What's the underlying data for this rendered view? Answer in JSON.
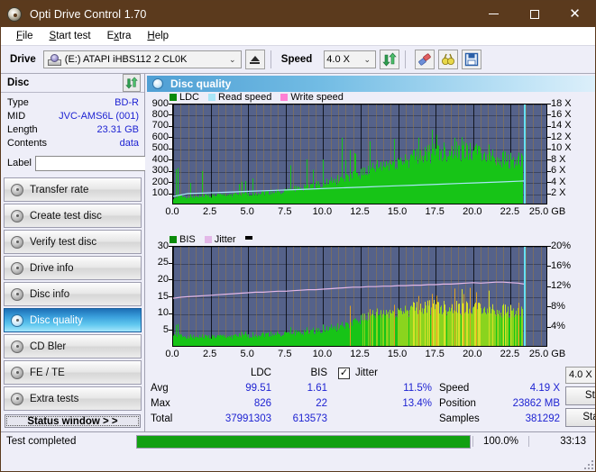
{
  "window": {
    "title": "Opti Drive Control 1.70",
    "icon": "disc-icon",
    "minimize": "–",
    "maximize": "□",
    "close": "✕"
  },
  "menu": [
    {
      "label": "File"
    },
    {
      "label": "Start test"
    },
    {
      "label": "Extra"
    },
    {
      "label": "Help"
    }
  ],
  "toolbar": {
    "drive_label": "Drive",
    "drive_value": "(E:)  ATAPI iHBS112  2 CL0K",
    "eject_icon": "eject-icon",
    "speed_label": "Speed",
    "speed_value": "4.0 X",
    "refresh_icon": "refresh-icon",
    "erase_icon": "eraser-icon",
    "tools_icon": "binoculars-icon",
    "save_icon": "save-disk-icon"
  },
  "sidebar": {
    "disc_header": "Disc",
    "refresh_icon": "refresh-icon",
    "info": [
      {
        "key": "Type",
        "value": "BD-R"
      },
      {
        "key": "MID",
        "value": "JVC-AMS6L (001)"
      },
      {
        "key": "Length",
        "value": "23.31 GB"
      },
      {
        "key": "Contents",
        "value": "data"
      }
    ],
    "label_key": "Label",
    "label_value": "",
    "label_placeholder": "",
    "label_button_icon": "cd-icon",
    "items": [
      {
        "label": "Transfer rate",
        "active": false
      },
      {
        "label": "Create test disc",
        "active": false
      },
      {
        "label": "Verify test disc",
        "active": false
      },
      {
        "label": "Drive info",
        "active": false
      },
      {
        "label": "Disc info",
        "active": false
      },
      {
        "label": "Disc quality",
        "active": true
      },
      {
        "label": "CD Bler",
        "active": false
      },
      {
        "label": "FE / TE",
        "active": false
      },
      {
        "label": "Extra tests",
        "active": false
      }
    ],
    "status_button": "Status window > >"
  },
  "panel": {
    "title": "Disc quality",
    "icon": "disc-quality-icon"
  },
  "stats": {
    "col_headers": [
      "LDC",
      "BIS"
    ],
    "row_labels": [
      "Avg",
      "Max",
      "Total"
    ],
    "ldc": {
      "avg": "99.51",
      "max": "826",
      "total": "37991303"
    },
    "bis": {
      "avg": "1.61",
      "max": "22",
      "total": "613573"
    },
    "jitter": {
      "checkbox_label": "Jitter",
      "checked": "✓",
      "avg": "11.5%",
      "max": "13.4%"
    },
    "speed_label": "Speed",
    "speed_value": "4.19 X",
    "position_label": "Position",
    "position_value": "23862 MB",
    "samples_label": "Samples",
    "samples_value": "381292",
    "speed_select": "4.0 X",
    "start_full": "Start full",
    "start_part": "Start part"
  },
  "statusbar": {
    "text": "Test completed",
    "percent": "100.0%",
    "percent_value": 100,
    "time": "33:13"
  },
  "colors": {
    "title_bar": "#5b3a1d",
    "accent_blue": "#1e23d2",
    "plot_bg": "#55628a",
    "ldc_green": "#17c417",
    "bis_green": "#17c417",
    "bis_yellow": "#d6e02a",
    "read_speed": "#a9e6f7",
    "write_speed": "#ff7fd4",
    "jitter_pink": "#e3b8e8",
    "cursor": "#63e0f5",
    "progress": "#12a012",
    "selected_nav": "#3a9fdc"
  },
  "chart_data": [
    {
      "type": "area",
      "name": "top-chart",
      "title": "",
      "xlabel": "GB",
      "ylabel": "",
      "legend": [
        {
          "name": "LDC",
          "color": "#17c417"
        },
        {
          "name": "Read speed",
          "color": "#a9e6f7"
        },
        {
          "name": "Write speed",
          "color": "#ff7fd4"
        }
      ],
      "legend_position": "top-left",
      "grid": true,
      "xlim": [
        0,
        25.0
      ],
      "xticks": [
        "0.0",
        "2.5",
        "5.0",
        "7.5",
        "10.0",
        "12.5",
        "15.0",
        "17.5",
        "20.0",
        "22.5",
        "25.0 GB"
      ],
      "xtick_values": [
        0,
        2.5,
        5.0,
        7.5,
        10.0,
        12.5,
        15.0,
        17.5,
        20.0,
        22.5,
        25.0
      ],
      "ylim": [
        0,
        900
      ],
      "yticks": [
        "100",
        "200",
        "300",
        "400",
        "500",
        "600",
        "700",
        "800",
        "900"
      ],
      "ytick_values": [
        100,
        200,
        300,
        400,
        500,
        600,
        700,
        800,
        900
      ],
      "y2lim": [
        0,
        18
      ],
      "y2ticks": [
        "2 X",
        "4 X",
        "6 X",
        "8 X",
        "10 X",
        "12 X",
        "14 X",
        "16 X",
        "18 X"
      ],
      "y2tick_values": [
        2,
        4,
        6,
        8,
        10,
        12,
        14,
        16,
        18
      ],
      "cursor_x": 23.4,
      "series": [
        {
          "name": "LDC",
          "type": "spike-area",
          "color": "#17c417",
          "x": [
            0.0,
            0.25,
            0.5,
            0.75,
            1.0,
            1.25,
            1.5,
            1.75,
            2.0,
            2.25,
            2.5,
            2.75,
            3.0,
            3.25,
            3.5,
            3.75,
            4.0,
            4.25,
            4.5,
            4.75,
            5.0,
            5.25,
            5.5,
            5.75,
            6.0,
            6.25,
            6.5,
            6.75,
            7.0,
            7.25,
            7.5,
            7.75,
            8.0,
            8.25,
            8.5,
            8.75,
            9.0,
            9.25,
            9.5,
            9.75,
            10.0,
            10.25,
            10.5,
            10.75,
            11.0,
            11.25,
            11.5,
            11.75,
            12.0,
            12.25,
            12.5,
            12.75,
            13.0,
            13.25,
            13.5,
            13.75,
            14.0,
            14.25,
            14.5,
            14.75,
            15.0,
            15.25,
            15.5,
            15.75,
            16.0,
            16.25,
            16.5,
            16.75,
            17.0,
            17.25,
            17.5,
            17.75,
            18.0,
            18.25,
            18.5,
            18.75,
            19.0,
            19.25,
            19.5,
            19.75,
            20.0,
            20.25,
            20.5,
            20.75,
            21.0,
            21.25,
            21.5,
            21.75,
            22.0,
            22.25,
            22.5,
            22.75,
            23.0,
            23.3
          ],
          "baseline": [
            60,
            80,
            85,
            80,
            78,
            80,
            82,
            80,
            85,
            88,
            85,
            90,
            92,
            90,
            95,
            98,
            95,
            100,
            98,
            100,
            105,
            108,
            110,
            112,
            115,
            118,
            120,
            125,
            128,
            130,
            135,
            145,
            150,
            155,
            160,
            170,
            175,
            180,
            190,
            195,
            200,
            210,
            215,
            225,
            235,
            245,
            255,
            265,
            275,
            285,
            300,
            310,
            320,
            330,
            340,
            350,
            360,
            370,
            380,
            390,
            400,
            410,
            420,
            430,
            435,
            445,
            455,
            465,
            470,
            478,
            485,
            490,
            495,
            498,
            500,
            498,
            495,
            490,
            485,
            480,
            478,
            472,
            468,
            462,
            455,
            448,
            440,
            432,
            425,
            415,
            405,
            398,
            390,
            380
          ],
          "peaks": [
            180,
            410,
            200,
            180,
            170,
            240,
            190,
            175,
            410,
            210,
            190,
            230,
            250,
            200,
            210,
            410,
            230,
            240,
            210,
            220,
            280,
            300,
            320,
            290,
            300,
            410,
            330,
            310,
            350,
            340,
            420,
            380,
            360,
            480,
            400,
            430,
            600,
            420,
            440,
            470,
            430,
            480,
            540,
            460,
            490,
            620,
            480,
            500,
            520,
            510,
            540,
            560,
            580,
            600,
            570,
            590,
            610,
            600,
            620,
            640,
            860,
            650,
            670,
            690,
            700,
            680,
            720,
            710,
            700,
            705,
            690,
            700,
            680,
            670,
            660,
            650,
            640,
            630,
            620,
            610,
            600,
            595,
            590,
            585,
            580,
            575,
            570,
            560,
            550,
            540,
            530,
            520,
            500,
            480
          ]
        },
        {
          "name": "Read speed",
          "type": "line",
          "color": "#a9e6f7",
          "axis": "right",
          "x": [
            0.0,
            1.0,
            2.0,
            3.0,
            4.0,
            5.0,
            6.0,
            7.0,
            8.0,
            9.0,
            10.0,
            11.0,
            12.0,
            13.0,
            14.0,
            15.0,
            16.0,
            17.0,
            18.0,
            19.0,
            20.0,
            21.0,
            22.0,
            23.0,
            23.4
          ],
          "values": [
            1.6,
            2.1,
            2.2,
            2.3,
            2.4,
            2.5,
            2.6,
            2.7,
            2.8,
            2.9,
            3.0,
            3.1,
            3.2,
            3.3,
            3.4,
            3.5,
            3.6,
            3.7,
            3.8,
            3.9,
            4.0,
            4.1,
            4.2,
            4.3,
            4.35
          ]
        },
        {
          "name": "Write speed",
          "type": "line",
          "color": "#ff7fd4",
          "axis": "right",
          "x": [],
          "values": []
        }
      ]
    },
    {
      "type": "area",
      "name": "bottom-chart",
      "title": "",
      "xlabel": "GB",
      "ylabel": "",
      "legend": [
        {
          "name": "BIS",
          "color": "#17c417"
        },
        {
          "name": "Jitter",
          "color": "#e3b8e8"
        }
      ],
      "legend_position": "top-left",
      "grid": true,
      "xlim": [
        0,
        25.0
      ],
      "xticks": [
        "0.0",
        "2.5",
        "5.0",
        "7.5",
        "10.0",
        "12.5",
        "15.0",
        "17.5",
        "20.0",
        "22.5",
        "25.0 GB"
      ],
      "xtick_values": [
        0,
        2.5,
        5.0,
        7.5,
        10.0,
        12.5,
        15.0,
        17.5,
        20.0,
        22.5,
        25.0
      ],
      "ylim": [
        0,
        30
      ],
      "yticks": [
        "5",
        "10",
        "15",
        "20",
        "25",
        "30"
      ],
      "ytick_values": [
        5,
        10,
        15,
        20,
        25,
        30
      ],
      "y2lim": [
        0,
        20
      ],
      "y2ticks": [
        "4%",
        "8%",
        "12%",
        "16%",
        "20%"
      ],
      "y2tick_values": [
        4,
        8,
        12,
        16,
        20
      ],
      "cursor_x": 23.4,
      "series": [
        {
          "name": "BIS",
          "type": "spike-area",
          "color": "#17c417",
          "color_high": "#d6e02a",
          "x": [
            0.0,
            0.25,
            0.5,
            0.75,
            1.0,
            1.25,
            1.5,
            1.75,
            2.0,
            2.25,
            2.5,
            2.75,
            3.0,
            3.25,
            3.5,
            3.75,
            4.0,
            4.25,
            4.5,
            4.75,
            5.0,
            5.25,
            5.5,
            5.75,
            6.0,
            6.25,
            6.5,
            6.75,
            7.0,
            7.25,
            7.5,
            7.75,
            8.0,
            8.25,
            8.5,
            8.75,
            9.0,
            9.25,
            9.5,
            9.75,
            10.0,
            10.25,
            10.5,
            10.75,
            11.0,
            11.25,
            11.5,
            11.75,
            12.0,
            12.25,
            12.5,
            12.75,
            13.0,
            13.25,
            13.5,
            13.75,
            14.0,
            14.25,
            14.5,
            14.75,
            15.0,
            15.25,
            15.5,
            15.75,
            16.0,
            16.25,
            16.5,
            16.75,
            17.0,
            17.25,
            17.5,
            17.75,
            18.0,
            18.25,
            18.5,
            18.75,
            19.0,
            19.25,
            19.5,
            19.75,
            20.0,
            20.25,
            20.5,
            20.75,
            21.0,
            21.25,
            21.5,
            21.75,
            22.0,
            22.25,
            22.5,
            22.75,
            23.0,
            23.3
          ],
          "baseline": [
            4.0,
            3.8,
            3.6,
            3.5,
            3.4,
            3.4,
            3.3,
            3.3,
            3.3,
            3.3,
            3.3,
            3.3,
            3.3,
            3.4,
            3.4,
            3.4,
            3.5,
            3.4,
            3.5,
            3.6,
            3.6,
            3.7,
            3.8,
            3.9,
            4.0,
            4.0,
            4.1,
            4.2,
            4.2,
            4.3,
            4.3,
            4.4,
            4.5,
            4.6,
            4.7,
            4.8,
            4.9,
            5.0,
            5.1,
            5.3,
            5.5,
            5.7,
            5.9,
            6.1,
            6.3,
            6.5,
            6.8,
            7.2,
            7.5,
            8.0,
            9.0,
            9.3,
            9.5,
            9.7,
            9.9,
            10.1,
            10.3,
            10.5,
            10.7,
            10.9,
            11.1,
            11.3,
            11.5,
            11.7,
            11.9,
            12.0,
            12.1,
            12.2,
            12.3,
            12.4,
            12.4,
            12.4,
            12.3,
            12.3,
            12.2,
            12.2,
            12.1,
            12.1,
            12.0,
            12.0,
            11.9,
            11.9,
            11.8,
            11.8,
            11.7,
            11.6,
            11.5,
            11.4,
            11.3,
            11.2,
            11.0,
            10.8,
            10.5,
            9.8
          ],
          "peaks": [
            4.2,
            8.2,
            4.5,
            4.2,
            4.0,
            4.1,
            4.0,
            4.0,
            4.2,
            4.1,
            4.0,
            4.2,
            4.3,
            4.3,
            4.2,
            4.3,
            7.0,
            4.5,
            4.6,
            4.8,
            6.0,
            5.0,
            5.2,
            5.3,
            5.5,
            5.6,
            5.5,
            5.6,
            5.7,
            5.8,
            5.9,
            6.2,
            6.5,
            6.4,
            6.3,
            6.5,
            6.8,
            6.7,
            6.9,
            7.0,
            7.1,
            7.0,
            7.2,
            7.3,
            7.5,
            7.7,
            8.0,
            13.2,
            8.5,
            9.5,
            12.0,
            11.0,
            11.5,
            11.8,
            12.5,
            12.0,
            12.3,
            12.6,
            13.0,
            13.2,
            13.5,
            13.8,
            14.0,
            18.8,
            14.5,
            16.0,
            19.5,
            15.5,
            19.5,
            16.5,
            17.0,
            16.0,
            19.0,
            17.5,
            18.0,
            20.0,
            17.8,
            18.5,
            19.0,
            22.0,
            18.5,
            19.5,
            18.0,
            18.5,
            19.5,
            17.5,
            18.0,
            17.0,
            17.5,
            16.5,
            16.0,
            15.0,
            14.5,
            12.0
          ]
        },
        {
          "name": "Jitter",
          "type": "line",
          "color": "#e3b8e8",
          "axis": "right",
          "x": [
            0.0,
            0.5,
            1.0,
            1.5,
            2.0,
            2.5,
            3.0,
            3.5,
            4.0,
            4.5,
            5.0,
            5.5,
            6.0,
            6.5,
            7.0,
            7.5,
            8.0,
            8.5,
            9.0,
            9.5,
            10.0,
            10.5,
            11.0,
            11.5,
            12.0,
            12.5,
            13.0,
            13.5,
            14.0,
            14.5,
            15.0,
            15.5,
            16.0,
            16.5,
            17.0,
            17.5,
            18.0,
            18.5,
            19.0,
            19.5,
            20.0,
            20.5,
            21.0,
            21.5,
            22.0,
            22.5,
            23.0,
            23.4
          ],
          "values": [
            9.8,
            10.0,
            10.1,
            10.2,
            10.3,
            10.4,
            10.5,
            10.6,
            10.7,
            10.8,
            10.9,
            11.0,
            11.0,
            11.1,
            11.2,
            11.2,
            11.3,
            11.4,
            11.5,
            11.5,
            11.6,
            11.7,
            11.8,
            11.9,
            12.0,
            12.0,
            12.1,
            12.1,
            12.2,
            12.2,
            12.3,
            12.3,
            12.4,
            12.4,
            12.5,
            12.5,
            12.6,
            12.6,
            12.7,
            12.8,
            12.9,
            12.8,
            12.9,
            13.0,
            13.0,
            12.9,
            12.8,
            12.6
          ]
        }
      ]
    }
  ]
}
